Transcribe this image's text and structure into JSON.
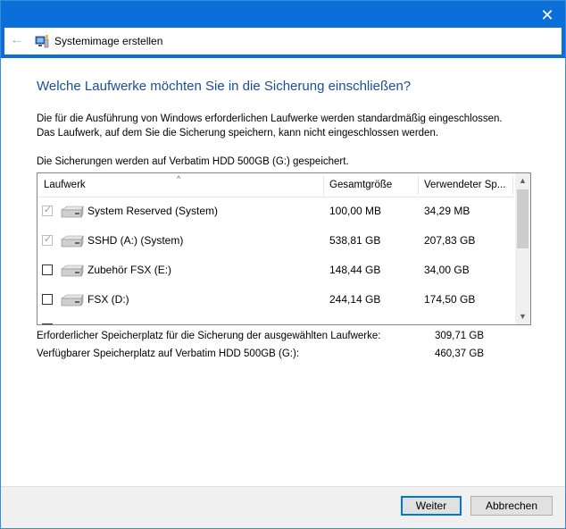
{
  "window": {
    "title": "Systemimage erstellen",
    "close_glyph": "✕",
    "back_glyph": "←"
  },
  "heading": "Welche Laufwerke möchten Sie in die Sicherung einschließen?",
  "info_line1": "Die für die Ausführung von Windows erforderlichen Laufwerke werden standardmäßig eingeschlossen.",
  "info_line2": "Das Laufwerk, auf dem Sie die Sicherung speichern, kann nicht eingeschlossen werden.",
  "saved_to": "Die Sicherungen werden auf Verbatim HDD 500GB (G:) gespeichert.",
  "table": {
    "columns": [
      "Laufwerk",
      "Gesamtgröße",
      "Verwendeter Sp..."
    ],
    "sort_glyph": "^",
    "rows": [
      {
        "name": "System Reserved (System)",
        "total": "100,00 MB",
        "used": "34,29 MB",
        "checked": true,
        "disabled": true
      },
      {
        "name": "SSHD (A:) (System)",
        "total": "538,81 GB",
        "used": "207,83 GB",
        "checked": true,
        "disabled": true
      },
      {
        "name": "Zubehör FSX (E:)",
        "total": "148,44 GB",
        "used": "34,00 GB",
        "checked": false,
        "disabled": false
      },
      {
        "name": "FSX (D:)",
        "total": "244,14 GB",
        "used": "174,50 GB",
        "checked": false,
        "disabled": false
      }
    ],
    "check_glyph": "✓",
    "scroll_up_glyph": "▲",
    "scroll_down_glyph": "▼",
    "scroll_position": 0
  },
  "summary": {
    "required_label": "Erforderlicher Speicherplatz für die Sicherung der ausgewählten Laufwerke:",
    "required_value": "309,71 GB",
    "available_label": "Verfügbarer Speicherplatz auf Verbatim HDD 500GB (G:):",
    "available_value": "460,37 GB"
  },
  "buttons": {
    "next": "Weiter",
    "cancel": "Abbrechen"
  },
  "colors": {
    "accent": "#0078d7",
    "titlebar": "#0a6fd8",
    "heading": "#1a4d9c"
  }
}
